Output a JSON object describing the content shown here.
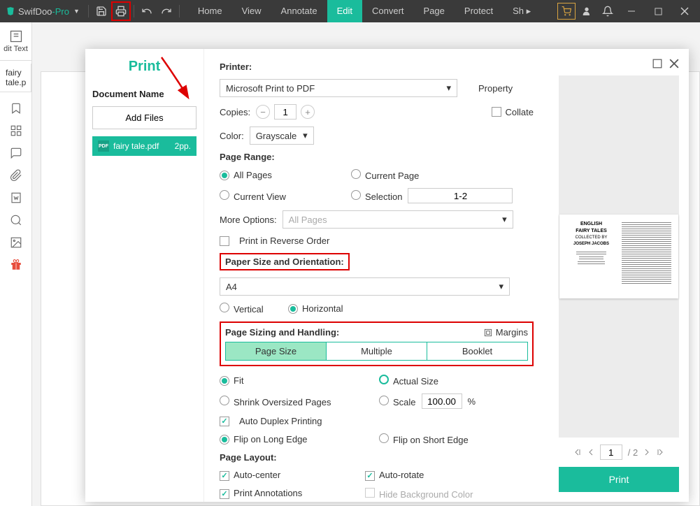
{
  "brand": {
    "name1": "SwifDoo",
    "name2": "-Pro"
  },
  "menu": {
    "home": "Home",
    "view": "View",
    "annotate": "Annotate",
    "edit": "Edit",
    "convert": "Convert",
    "page": "Page",
    "protect": "Protect",
    "share": "Sh"
  },
  "left": {
    "edit_text": "dit Text",
    "file_tab": "fairy tale.p"
  },
  "dialog": {
    "title": "Print",
    "docname_label": "Document Name",
    "add_files": "Add Files",
    "file": {
      "name": "fairy tale.pdf",
      "pages": "2pp."
    },
    "printer_label": "Printer:",
    "printer_value": "Microsoft Print to PDF",
    "property": "Property",
    "copies_label": "Copies:",
    "copies_value": "1",
    "collate": "Collate",
    "color_label": "Color:",
    "color_value": "Grayscale",
    "range_label": "Page Range:",
    "all_pages": "All Pages",
    "current_page": "Current Page",
    "current_view": "Current View",
    "selection": "Selection",
    "selection_value": "1-2",
    "more_options": "More Options:",
    "more_value": "All Pages",
    "reverse": "Print in Reverse Order",
    "paper_label": "Paper Size and Orientation:",
    "paper_value": "A4",
    "vertical": "Vertical",
    "horizontal": "Horizontal",
    "sizing_label": "Page Sizing and Handling:",
    "margins": "Margins",
    "tabs": {
      "size": "Page Size",
      "multiple": "Multiple",
      "booklet": "Booklet"
    },
    "fit": "Fit",
    "actual": "Actual Size",
    "shrink": "Shrink Oversized Pages",
    "scale": "Scale",
    "scale_value": "100.00",
    "pct": "%",
    "duplex": "Auto Duplex Printing",
    "long_edge": "Flip on Long Edge",
    "short_edge": "Flip on Short Edge",
    "layout_label": "Page Layout:",
    "auto_center": "Auto-center",
    "auto_rotate": "Auto-rotate",
    "annotations": "Print Annotations",
    "hide_bg": "Hide Background Color",
    "preview": {
      "t1": "ENGLISH",
      "t2": "FAIRY TALES",
      "t3": "COLLECTED BY",
      "t4": "JOSEPH JACOBS"
    },
    "pager": {
      "current": "1",
      "total": "/ 2"
    },
    "print_btn": "Print"
  }
}
